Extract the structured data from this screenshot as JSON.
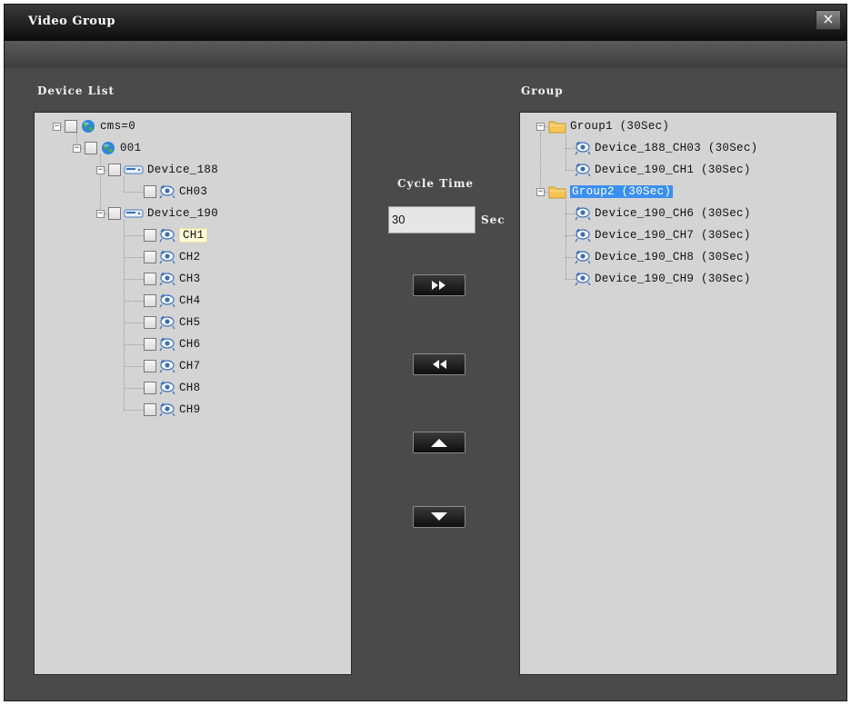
{
  "window": {
    "title": "Video Group",
    "close_label": "×"
  },
  "device_list": {
    "label": "Device List",
    "tree": {
      "root": {
        "label": "cms=0"
      },
      "site": {
        "label": "001"
      },
      "device_188": {
        "label": "Device_188",
        "channels": [
          "CH03"
        ]
      },
      "device_190": {
        "label": "Device_190",
        "channels": [
          "CH1",
          "CH2",
          "CH3",
          "CH4",
          "CH5",
          "CH6",
          "CH7",
          "CH8",
          "CH9"
        ],
        "selected": "CH1"
      }
    }
  },
  "cycle": {
    "label": "Cycle Time",
    "value": "30",
    "unit": "Sec"
  },
  "controls": [
    {
      "name": "add-to-group-button",
      "icon": "double-right-arrow-icon"
    },
    {
      "name": "remove-from-group-button",
      "icon": "double-left-arrow-icon"
    },
    {
      "name": "move-up-button",
      "icon": "up-triangle-icon"
    },
    {
      "name": "move-down-button",
      "icon": "down-triangle-icon"
    }
  ],
  "group": {
    "label": "Group",
    "groups": [
      {
        "label": "Group1 (30Sec)",
        "items": [
          "Device_188_CH03 (30Sec)",
          "Device_190_CH1 (30Sec)"
        ]
      },
      {
        "label": "Group2 (30Sec)",
        "selected": true,
        "items": [
          "Device_190_CH6 (30Sec)",
          "Device_190_CH7 (30Sec)",
          "Device_190_CH8 (30Sec)",
          "Device_190_CH9 (30Sec)"
        ]
      }
    ]
  },
  "colors": {
    "window_bg": "#4a4a4a",
    "panel_bg": "#d4d4d4",
    "selection_blue": "#3b8ff0",
    "selection_yellow": "#fffbd6"
  }
}
